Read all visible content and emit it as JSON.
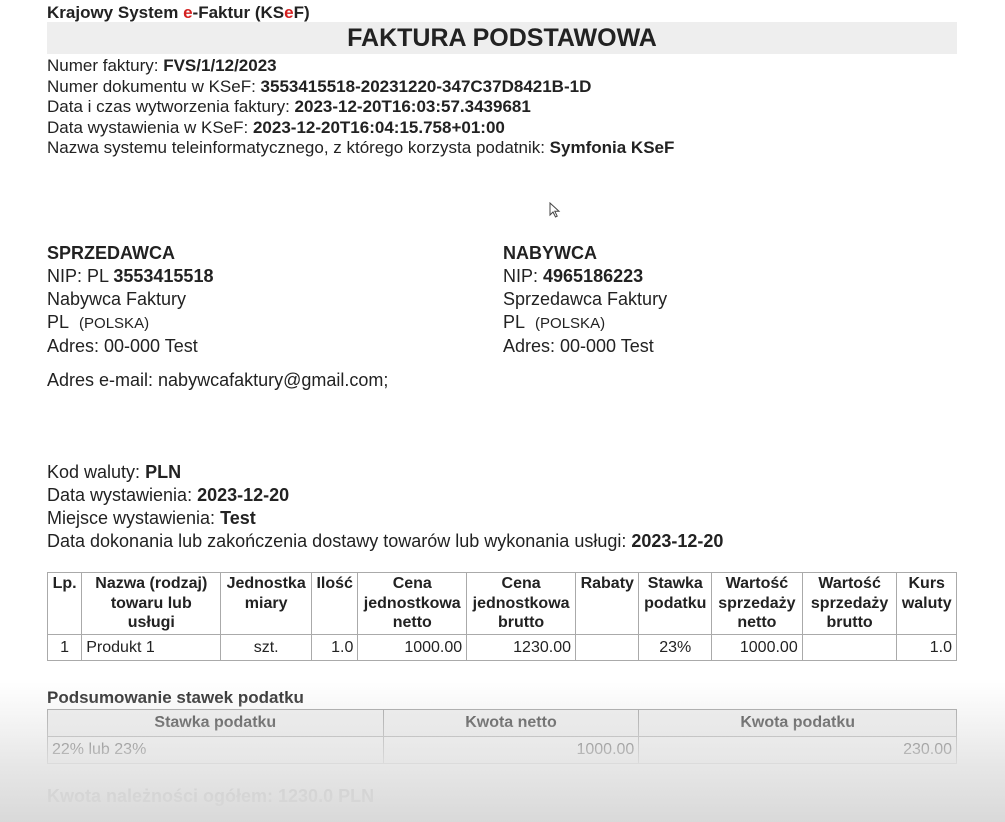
{
  "header": {
    "system_prefix": "Krajowy System ",
    "system_e": "e",
    "system_mid": "-Faktur (KS",
    "system_e2": "e",
    "system_suffix": "F)",
    "title": "FAKTURA PODSTAWOWA"
  },
  "meta": [
    {
      "label": "Numer faktury: ",
      "value": "FVS/1/12/2023"
    },
    {
      "label": "Numer dokumentu w KSeF: ",
      "value": "3553415518-20231220-347C37D8421B-1D"
    },
    {
      "label": "Data i czas wytworzenia faktury: ",
      "value": "2023-12-20T16:03:57.3439681"
    },
    {
      "label": "Data wystawienia w KSeF: ",
      "value": "2023-12-20T16:04:15.758+01:00"
    },
    {
      "label": "Nazwa systemu teleinformatycznego, z którego korzysta podatnik: ",
      "value": "Symfonia KSeF"
    }
  ],
  "seller": {
    "heading": "SPRZEDAWCA",
    "nip_label": "NIP: PL ",
    "nip": "3553415518",
    "name": "Nabywca Faktury",
    "country_code": "PL",
    "country": "(POLSKA)",
    "address": "Adres: 00-000 Test"
  },
  "buyer": {
    "heading": "NABYWCA",
    "nip_label": "NIP: ",
    "nip": "4965186223",
    "name": "Sprzedawca Faktury",
    "country_code": "PL",
    "country": "(POLSKA)",
    "address": "Adres: 00-000 Test"
  },
  "email": "Adres e-mail: nabywcafaktury@gmail.com;",
  "details": [
    {
      "label": "Kod waluty: ",
      "value": "PLN"
    },
    {
      "label": "Data wystawienia: ",
      "value": "2023-12-20"
    },
    {
      "label": "Miejsce wystawienia: ",
      "value": "Test"
    },
    {
      "label": "Data dokonania lub zakończenia dostawy towarów lub wykonania usługi: ",
      "value": "2023-12-20"
    }
  ],
  "items_table": {
    "headers": [
      "Lp.",
      "Nazwa (rodzaj) towaru lub usługi",
      "Jednostka miary",
      "Ilość",
      "Cena jednostkowa netto",
      "Cena jednostkowa brutto",
      "Rabaty",
      "Stawka podatku",
      "Wartość sprzedaży netto",
      "Wartość sprzedaży brutto",
      "Kurs waluty"
    ],
    "rows": [
      [
        "1",
        "Produkt 1",
        "szt.",
        "1.0",
        "1000.00",
        "1230.00",
        "",
        "23%",
        "1000.00",
        "",
        "1.0"
      ]
    ]
  },
  "summary": {
    "title": "Podsumowanie stawek podatku",
    "headers": [
      "Stawka podatku",
      "Kwota netto",
      "Kwota podatku"
    ],
    "rows": [
      [
        "22% lub 23%",
        "1000.00",
        "230.00"
      ]
    ]
  },
  "total": "Kwota należności ogółem: 1230.0 PLN",
  "colors": {
    "accent_red": "#d42020",
    "title_band": "#eeeeee"
  },
  "icons": {
    "cursor": "mouse-pointer-icon"
  }
}
